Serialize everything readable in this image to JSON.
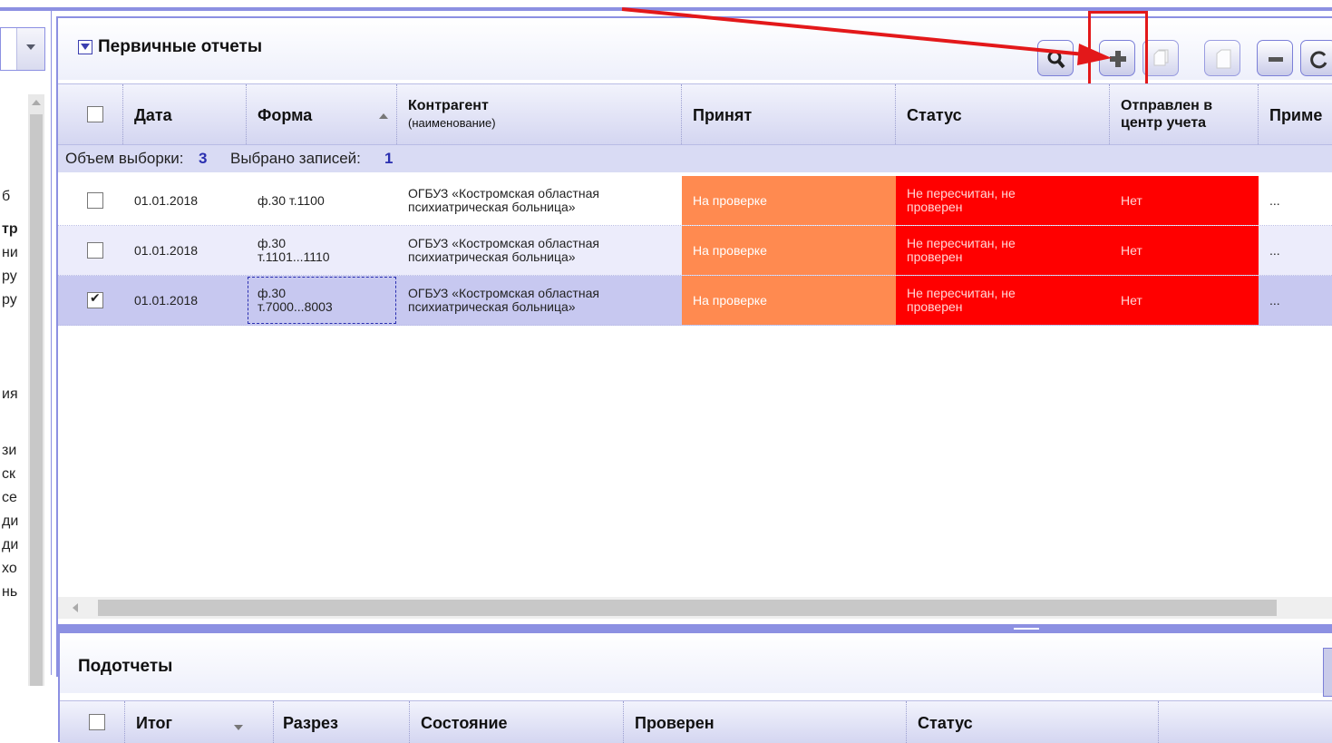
{
  "left_fragments": [
    "б",
    "тр",
    "ни",
    "ру",
    "ру",
    "ия",
    "зи",
    "ск",
    "се",
    "ди",
    "ди",
    "хо",
    "нь"
  ],
  "main": {
    "title": "Первичные отчеты"
  },
  "toolbar": {
    "search": "search-icon",
    "add": "plus-icon",
    "copy": "copy-icon",
    "new": "document-icon",
    "remove": "minus-icon",
    "refresh": "refresh-icon"
  },
  "table": {
    "columns": {
      "date": "Дата",
      "form": "Форма",
      "contractor": "Контрагент",
      "contractor_sub": "(наименование)",
      "accepted": "Принят",
      "status": "Статус",
      "sent_line1": "Отправлен в",
      "sent_line2": "центр учета",
      "note": "Приме"
    },
    "summary": {
      "volume_label": "Объем выборки:",
      "volume_value": "3",
      "selected_label": "Выбрано записей:",
      "selected_value": "1"
    },
    "rows": [
      {
        "checked": false,
        "date": "01.01.2018",
        "form_line1": "ф.30 т.1100",
        "form_line2": "",
        "contractor_line1": "ОГБУЗ «Костромская областная",
        "contractor_line2": "психиатрическая больница»",
        "accepted": "На проверке",
        "status_line1": "Не пересчитан, не",
        "status_line2": "проверен",
        "sent": "Нет",
        "note": "..."
      },
      {
        "checked": false,
        "date": "01.01.2018",
        "form_line1": "ф.30",
        "form_line2": "т.1101...1110",
        "contractor_line1": "ОГБУЗ «Костромская областная",
        "contractor_line2": "психиатрическая больница»",
        "accepted": "На проверке",
        "status_line1": "Не пересчитан, не",
        "status_line2": "проверен",
        "sent": "Нет",
        "note": "..."
      },
      {
        "checked": true,
        "date": "01.01.2018",
        "form_line1": "ф.30",
        "form_line2": "т.7000...8003",
        "contractor_line1": "ОГБУЗ «Костромская областная",
        "contractor_line2": "психиатрическая больница»",
        "accepted": "На проверке",
        "status_line1": "Не пересчитан, не",
        "status_line2": "проверен",
        "sent": "Нет",
        "note": "..."
      }
    ]
  },
  "sub_panel": {
    "title": "Подотчеты",
    "columns": {
      "total": "Итог",
      "section": "Разрез",
      "state": "Состояние",
      "checked": "Проверен",
      "status": "Статус"
    }
  },
  "colors": {
    "accent": "#8c90e2",
    "accepted_bg": "#ff8a50",
    "status_bg": "#ff0000",
    "annotation": "#e3181a"
  }
}
